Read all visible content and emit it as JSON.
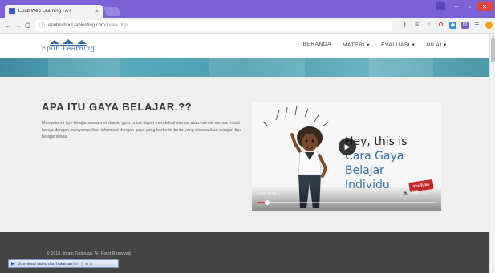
{
  "browser": {
    "tab_title": "Epub Web Learning - A I",
    "tab_close": "×",
    "url_host": "epubschool.tablosting.com",
    "url_path": "/index.php",
    "window_controls": {
      "minimize": "–",
      "maximize": "▫",
      "close": "✕"
    },
    "extension_icons": [
      "key-icon",
      "reader-icon",
      "star-icon",
      "opera-icon",
      "extension-icon",
      "mail-icon",
      "menu-icon",
      "warning-icon"
    ]
  },
  "site": {
    "logo_text": "Epub Learning",
    "nav": [
      {
        "label": "BERANDA"
      },
      {
        "label": "MATERI ▾"
      },
      {
        "label": "EVALUASI ▾"
      },
      {
        "label": "NILAI ▾"
      }
    ]
  },
  "main": {
    "title": "APA ITU GAYA BELAJAR.??",
    "description": "Mengetahui tipe belajar siswa membantu guru untuk dapat mendekati semua atau hampir semua murid hanya dengan menyampaikan informasi dengan gaya yang berbeda-beda yang disesuaikan dengan tipe belajar siswa."
  },
  "video": {
    "line1": "Hey, this is",
    "line2": "Cara Gaya",
    "line3": "Belajar",
    "line4": "Individu",
    "time": "0:06 / 1:39",
    "progress_fraction": 0.06,
    "play_glyph": "▶",
    "badge": "YouTube",
    "controls_glyphs": [
      "🔊",
      "HD",
      "⛶"
    ]
  },
  "footer": {
    "copyright": "© 2018. Imam Taqiyuan. All Right Reserved",
    "download_label": "Download video dari halaman ini",
    "download_extra": "⋮ ⊕ ✕"
  },
  "colors": {
    "titlebar": "#7b62d6",
    "banner": "#4e9daf",
    "footer": "#444444",
    "section_bg": "#efefef",
    "logo": "#3b6ea8"
  }
}
